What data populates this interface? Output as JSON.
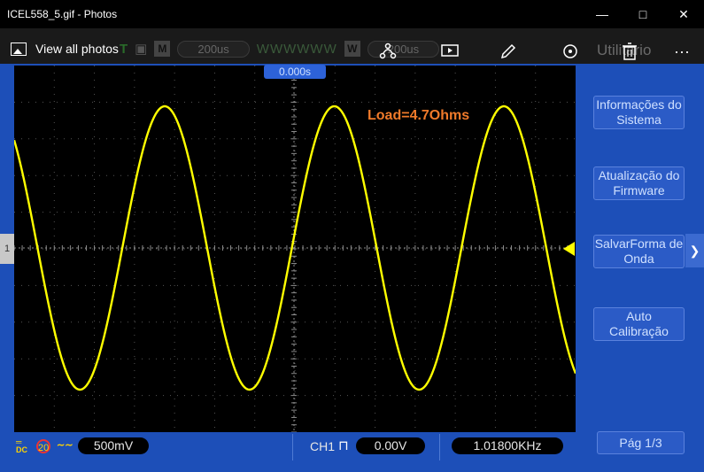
{
  "window": {
    "title": "ICEL558_5.gif - Photos",
    "minimize_icon": "minimize-icon",
    "maximize_icon": "maximize-icon",
    "close_icon": "close-icon"
  },
  "photos_toolbar": {
    "view_all_label": "View all photos",
    "tools": [
      "people-tag-icon",
      "slideshow-icon",
      "edit-pen-icon",
      "rotate-icon",
      "delete-icon",
      "more-icon"
    ],
    "more_label": "···"
  },
  "scope_ghost": {
    "time_div": "200us",
    "time_div_2": "200us",
    "t_label": "T",
    "m_label": "M",
    "w_label": "W",
    "utility_label": "Utilitario"
  },
  "scope": {
    "trigger_time": "0.000s",
    "annotation": "Load=4.7Ohms",
    "left_marker": "1",
    "trace_color": "#ffff00",
    "annotation_color": "#f07a2a",
    "frame_color": "#1d4fb8"
  },
  "menu": {
    "items": [
      {
        "line1": "Informações do",
        "line2": "Sistema"
      },
      {
        "line1": "Atualização do",
        "line2": "Firmware"
      },
      {
        "line1": "SalvarForma de",
        "line2": "Onda"
      },
      {
        "line1": "Auto",
        "line2": "Calibração"
      }
    ],
    "page": "Pág  1/3"
  },
  "status": {
    "coupling": "DC",
    "bw_limit": "20",
    "volts_div": "500mV",
    "channel": "CH1",
    "trigger_level": "0.00V",
    "frequency": "1.01800KHz"
  }
}
